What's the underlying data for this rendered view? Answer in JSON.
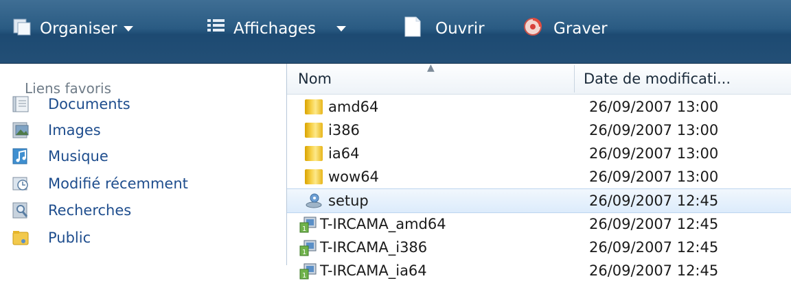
{
  "toolbar": {
    "organize": "Organiser",
    "views": "Affichages",
    "open": "Ouvrir",
    "burn": "Graver"
  },
  "nav": {
    "title": "Liens favoris",
    "items": [
      {
        "label": "Documents",
        "icon": "documents-icon"
      },
      {
        "label": "Images",
        "icon": "images-icon"
      },
      {
        "label": "Musique",
        "icon": "music-icon"
      },
      {
        "label": "Modifié récemment",
        "icon": "recent-icon"
      },
      {
        "label": "Recherches",
        "icon": "searches-icon"
      },
      {
        "label": "Public",
        "icon": "public-folder-icon"
      }
    ]
  },
  "list": {
    "columns": {
      "name": "Nom",
      "date": "Date de modificati..."
    },
    "rows": [
      {
        "name": "amd64",
        "date": "26/09/2007 13:00",
        "type": "folder"
      },
      {
        "name": "i386",
        "date": "26/09/2007 13:00",
        "type": "folder"
      },
      {
        "name": "ia64",
        "date": "26/09/2007 13:00",
        "type": "folder"
      },
      {
        "name": "wow64",
        "date": "26/09/2007 13:00",
        "type": "folder"
      },
      {
        "name": "setup",
        "date": "26/09/2007 12:45",
        "type": "setup",
        "selected": true
      },
      {
        "name": "T-IRCAMA_amd64",
        "date": "26/09/2007 12:45",
        "type": "installer"
      },
      {
        "name": "T-IRCAMA_i386",
        "date": "26/09/2007 12:45",
        "type": "installer"
      },
      {
        "name": "T-IRCAMA_ia64",
        "date": "26/09/2007 12:45",
        "type": "installer"
      }
    ]
  }
}
